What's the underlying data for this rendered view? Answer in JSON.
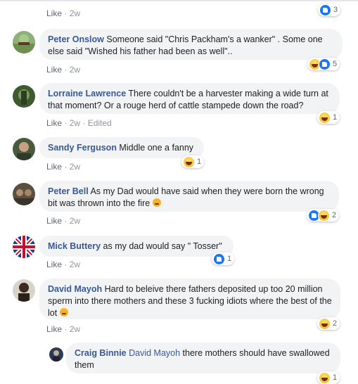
{
  "comments": [
    {
      "author": "",
      "text": "",
      "meta_like": "Like",
      "meta_time": "· 2w",
      "meta_extra": "",
      "reactions": {
        "types": [
          "like"
        ],
        "count": "3"
      }
    },
    {
      "author": "Peter Onslow",
      "text": "Someone said \"Chris Packham's a wanker\" . Some one else said \"Wished his father had been as well\"..",
      "meta_like": "Like",
      "meta_time": "· 2w",
      "meta_extra": "",
      "reactions": {
        "types": [
          "haha",
          "like"
        ],
        "count": "5"
      }
    },
    {
      "author": "Lorraine Lawrence",
      "text": "There couldn't be a harvester making a wide turn at that moment? Or a rouge herd of cattle stampede down the road?",
      "meta_like": "Like",
      "meta_time": "· 2w",
      "meta_extra": "· Edited",
      "reactions": {
        "types": [
          "haha"
        ],
        "count": "1"
      }
    },
    {
      "author": "Sandy Ferguson",
      "text": "Middle one a fanny",
      "meta_like": "Like",
      "meta_time": "· 2w",
      "meta_extra": "",
      "reactions": {
        "types": [
          "haha"
        ],
        "count": "1"
      }
    },
    {
      "author": "Peter Bell",
      "text": "As my Dad would have said when they were born the wrong bit was thrown into the fire",
      "meta_like": "Like",
      "meta_time": "· 2w",
      "meta_extra": "",
      "reactions": {
        "types": [
          "like",
          "haha"
        ],
        "count": "2"
      }
    },
    {
      "author": "Mick Buttery",
      "text": "as my dad would say \" Tosser\"",
      "meta_like": "Like",
      "meta_time": "· 2w",
      "meta_extra": "",
      "reactions": {
        "types": [
          "like"
        ],
        "count": "1"
      }
    },
    {
      "author": "David Mayoh",
      "text": "Hard to beleive there fathers deposited up too 20 million sperm into there mothers and these 3 fucking idiots where the best of the lot",
      "meta_like": "Like",
      "meta_time": "· 2w",
      "meta_extra": "",
      "reactions": {
        "types": [
          "haha"
        ],
        "count": "2"
      }
    },
    {
      "author": "Craig Binnie",
      "mention": "David Mayoh",
      "text": "there mothers should have swallowed them",
      "meta_like": "",
      "meta_time": "",
      "meta_extra": "",
      "reactions": {
        "types": [
          "haha"
        ],
        "count": "1"
      }
    }
  ]
}
